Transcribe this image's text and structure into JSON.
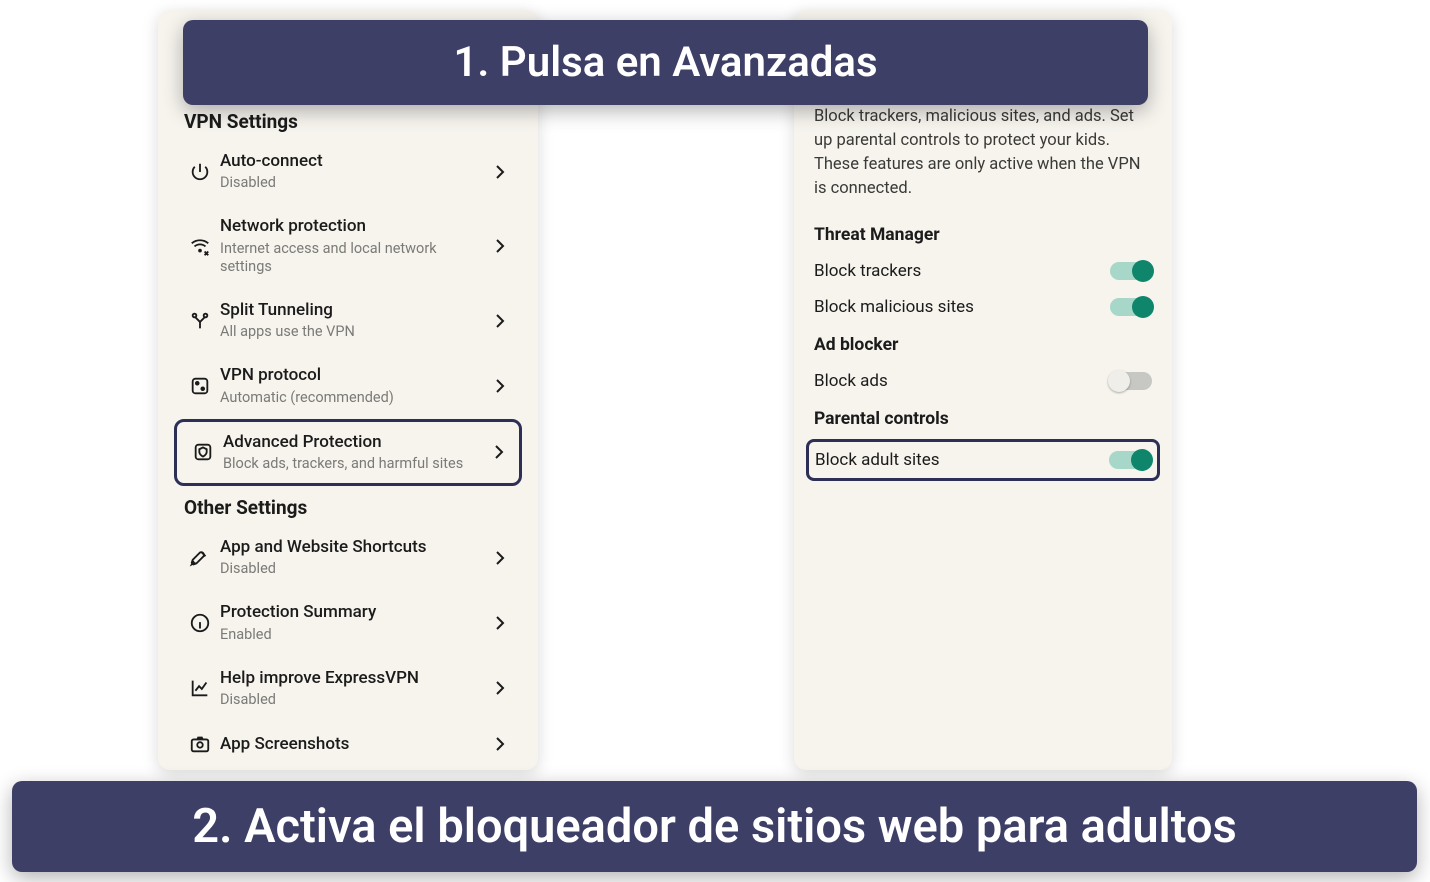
{
  "callouts": {
    "step1": "1.   Pulsa en Avanzadas",
    "step2": "2.   Activa el bloqueador de sitios web para adultos"
  },
  "left": {
    "section_vpn": "VPN Settings",
    "section_other": "Other Settings",
    "items": [
      {
        "title": "Auto-connect",
        "sub": "Disabled"
      },
      {
        "title": "Network protection",
        "sub": "Internet access and local network settings"
      },
      {
        "title": "Split Tunneling",
        "sub": "All apps use the VPN"
      },
      {
        "title": "VPN protocol",
        "sub": "Automatic (recommended)"
      },
      {
        "title": "Advanced Protection",
        "sub": "Block ads, trackers, and harmful sites"
      },
      {
        "title": "App and Website Shortcuts",
        "sub": "Disabled"
      },
      {
        "title": "Protection Summary",
        "sub": "Enabled"
      },
      {
        "title": "Help improve ExpressVPN",
        "sub": "Disabled"
      },
      {
        "title": "App Screenshots",
        "sub": ""
      }
    ]
  },
  "right": {
    "description": "Block trackers, malicious sites, and ads. Set up parental controls to protect your kids. These features are only active when the VPN is connected.",
    "section_threat": "Threat Manager",
    "section_ad": "Ad blocker",
    "section_parental": "Parental controls",
    "toggles": {
      "block_trackers": {
        "label": "Block trackers",
        "on": true
      },
      "block_malicious": {
        "label": "Block malicious sites",
        "on": true
      },
      "block_ads": {
        "label": "Block ads",
        "on": false
      },
      "block_adult": {
        "label": "Block adult sites",
        "on": true
      }
    }
  }
}
